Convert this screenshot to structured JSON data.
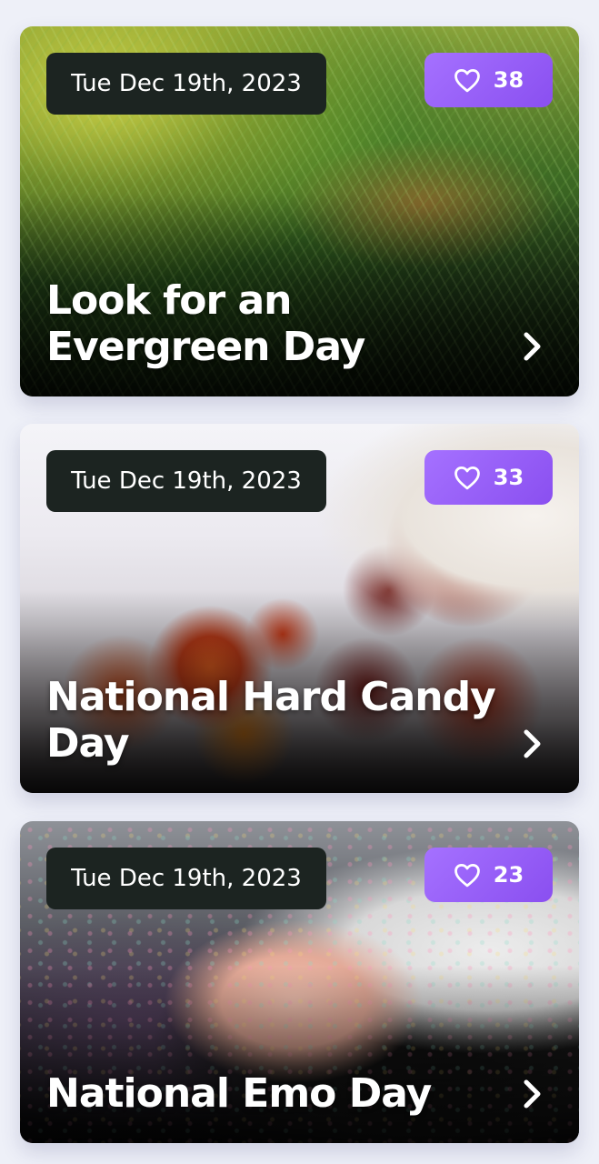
{
  "cards": [
    {
      "date": "Tue Dec 19th, 2023",
      "likes": "38",
      "title": "Look for an Evergreen Day",
      "image": "pine-branches-photo"
    },
    {
      "date": "Tue Dec 19th, 2023",
      "likes": "33",
      "title": "National Hard Candy Day",
      "image": "hard-candy-photo"
    },
    {
      "date": "Tue Dec 19th, 2023",
      "likes": "23",
      "title": "National Emo Day",
      "image": "emo-portrait-photo"
    }
  ],
  "icons": {
    "like": "heart-icon",
    "open": "chevron-right-icon"
  },
  "colors": {
    "page_background": "#eef0f8",
    "date_badge": "#1c2421",
    "like_badge_start": "#a571ff",
    "like_badge_end": "#8a4ff0",
    "text": "#ffffff"
  }
}
